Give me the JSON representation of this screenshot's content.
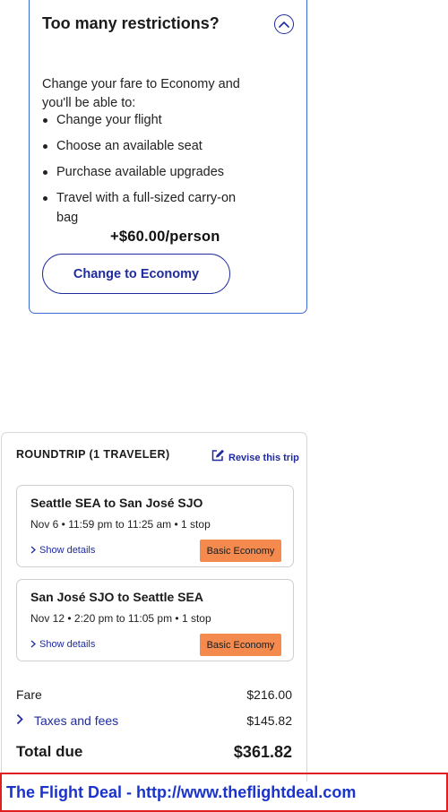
{
  "upsell": {
    "title": "Too many restrictions?",
    "intro": "Change your fare to Economy and you'll be able to:",
    "benefits": [
      "Change your flight",
      "Choose an available seat",
      "Purchase available upgrades",
      "Travel with a full-sized carry-on bag"
    ],
    "price": "+$60.00/person",
    "button_label": "Change to Economy",
    "collapse_icon": "chevron-up-icon"
  },
  "trip": {
    "header": "ROUNDTRIP (1 TRAVELER)",
    "revise_label": "Revise this trip",
    "revise_icon": "edit-icon",
    "segments": [
      {
        "route": "Seattle SEA to San José SJO",
        "time": "Nov 6 • 11:59 pm to 11:25 am • 1 stop",
        "details_label": "Show details",
        "fare_class": "Basic Economy"
      },
      {
        "route": "San José SJO to Seattle SEA",
        "time": "Nov 12 • 2:20 pm to 11:05 pm • 1 stop",
        "details_label": "Show details",
        "fare_class": "Basic Economy"
      }
    ],
    "fare_label": "Fare",
    "fare_value": "$216.00",
    "taxes_label": "Taxes and fees",
    "taxes_value": "$145.82",
    "total_label": "Total due",
    "total_value": "$361.82"
  },
  "banner": {
    "text": "The Flight Deal - http://www.theflightdeal.com"
  },
  "colors": {
    "brand_blue": "#1f2b9e",
    "card_border_blue": "#3b6bd1",
    "badge_orange": "#f58a4f",
    "banner_red": "#e02020",
    "banner_text_blue": "#1a33cc"
  }
}
